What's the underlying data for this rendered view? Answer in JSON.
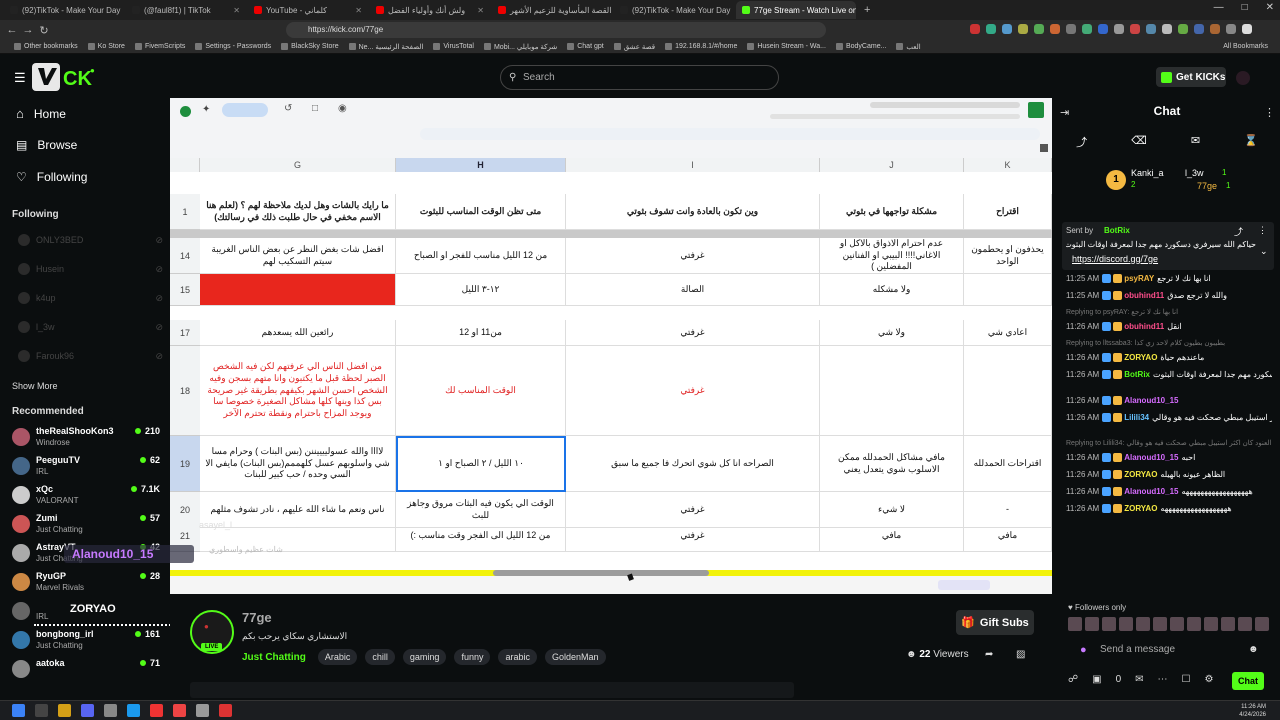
{
  "browser": {
    "tabs": [
      {
        "title": "(92)TikTok - Make Your Day",
        "color": "#222"
      },
      {
        "title": "(@faul8f1) | TikTok",
        "color": "#222"
      },
      {
        "title": "YouTube - كلماني",
        "color": "#e00"
      },
      {
        "title": "ولش أنك وأولياء الفضل",
        "color": "#e00"
      },
      {
        "title": "القصة المأساوية للزعيم الأشهر",
        "color": "#e00"
      },
      {
        "title": "(92)TikTok - Make Your Day",
        "color": "#222"
      },
      {
        "title": "77ge Stream - Watch Live on",
        "color": "#53fc18",
        "active": true
      }
    ],
    "url": "https://kick.com/77ge",
    "bookmarks": [
      "Other bookmarks",
      "Ko Store",
      "FivemScripts",
      "Settings - Passwords",
      "BlackSky Store",
      "Ne... الصفحة الرئيسية",
      "VirusTotal",
      "Mobi... شركة موبايلي",
      "Chat gpt",
      "قصة عشق",
      "192.168.8.1/#/home",
      "Husein Stream - Wa...",
      "BodyCame...",
      "العب"
    ],
    "all_bookmarks": "All Bookmarks"
  },
  "header": {
    "search_placeholder": "Search",
    "get_kicks": "Get KICKs"
  },
  "sidebar": {
    "nav": [
      {
        "label": "Home",
        "icon": "home-icon"
      },
      {
        "label": "Browse",
        "icon": "browse-icon"
      },
      {
        "label": "Following",
        "icon": "heart-icon"
      }
    ],
    "following_title": "Following",
    "following": [
      "ONLY3BED",
      "Husein",
      "k4up",
      "l_3w",
      "Farouk96"
    ],
    "show_more": "Show More",
    "recommended_title": "Recommended",
    "recommended": [
      {
        "name": "theRealShooKon3",
        "cat": "Windrose",
        "viewers": "210"
      },
      {
        "name": "PeeguuTV",
        "cat": "IRL",
        "viewers": "62"
      },
      {
        "name": "xQc",
        "cat": "VALORANT",
        "viewers": "7.1K"
      },
      {
        "name": "Zumi",
        "cat": "Just Chatting",
        "viewers": "57"
      },
      {
        "name": "AstrayVT",
        "cat": "Just Chatting",
        "viewers": "42"
      },
      {
        "name": "RyuGP",
        "cat": "Marvel Rivals",
        "viewers": "28"
      },
      {
        "name": "",
        "cat": "IRL",
        "viewers": ""
      },
      {
        "name": "bongbong_irl",
        "cat": "Just Chatting",
        "viewers": "161"
      },
      {
        "name": "aatoka",
        "cat": "",
        "viewers": "71"
      }
    ]
  },
  "sheet": {
    "columns": [
      "G",
      "H",
      "I",
      "J",
      "K"
    ],
    "rows": [
      {
        "n": "1",
        "cells": [
          "ما رايك بالشات وهل لديك ملاحظة لهم ؟ (لعلم هنا الاسم مخفي في حال طلبت ذلك في رسالتك)",
          "متى تظن الوقت المناسب للبثوت",
          "وين تكون بالعادة وانت تشوف بثوتي",
          "مشكلة تواجهها في بثوتي",
          "اقتراح"
        ]
      },
      {
        "n": "14",
        "cells": [
          "افضل شات بغض النظر عن بعض الناس الغريبة سيتم التسكيب لهم",
          "من 12 الليل مناسب للفجر او الصباح",
          "غرفتي",
          "عدم احترام الاذواق بالاكل او الاغاني!!!! البيبي او الفنانين المفضلين )",
          "يحذفون او يحطمون الواحد"
        ]
      },
      {
        "n": "15",
        "cells": [
          "",
          "١٢-٣ الليل",
          "الصالة",
          "ولا مشكله",
          ""
        ]
      },
      {
        "n": "17",
        "cells": [
          "رائعين الله يسعدهم",
          "من11 او 12",
          "غرفتي",
          "ولا شي",
          "اعادي شي"
        ]
      },
      {
        "n": "18",
        "cells": [
          "من افضل الناس الي عرفتهم لكن فيه الشخص الصبر لحظة قبل ما يكتبون وانا متهم بسجن وفيه الشخص احسن الشهر بكيفهم بطريقة غير صريحة بس كذا وينها كلها مشاكل الصغيرة خصوصا سا ويوجد المزاح باحترام ونقطة تحترم الآخر",
          "الوقت المناسب لك",
          "غرفتي",
          "",
          ""
        ]
      },
      {
        "n": "19",
        "cells": [
          "لاااا والله عسولييييننن (بس البنات ) وحرام مسا شي واسلوبهم عسل كلهممم(بس البنات) مايفي الا السي وحده / حب كبير للبنات",
          "١٠ الليل / ٢ الصباح او ١",
          "الصراحه انا كل شوي اتحرك فا جميع ما سبق",
          "مافي مشاكل الحمدلله ممكن الاسلوب شوي يتعدل يعني",
          "اقتراحات الحمدلله"
        ]
      },
      {
        "n": "20",
        "cells": [
          "ناس ونعم ما شاء الله عليهم ، نادر تشوف مثلهم",
          "الوقت الي يكون فيه البثات مروق وجاهز للبث",
          "غرفتي",
          "لا شيء",
          "-"
        ]
      },
      {
        "n": "21",
        "cells": [
          "",
          "من 12 الليل الى الفجر وقت مناسب :)",
          "غرفتي",
          "مافي",
          "مافي"
        ]
      }
    ],
    "overlay_names": {
      "alanoud": "Alanoud10_15",
      "zoryao": "ZORYAO",
      "asayel": "asayel_l",
      "line": "شات عظيم واسطوري"
    }
  },
  "stream": {
    "channel": "77ge",
    "title": "الاستشاري سكاي يرحب بكم",
    "live": "LIVE",
    "category": "Just Chatting",
    "tags": [
      "Arabic",
      "chill",
      "gaming",
      "funny",
      "arabic",
      "GoldenMan"
    ],
    "gift_subs": "Gift Subs",
    "viewers": "22",
    "viewers_label": "Viewers"
  },
  "chat": {
    "title": "Chat",
    "top_gifters": [
      {
        "name": "Kanki_a",
        "n": "2"
      },
      {
        "name": "l_3w",
        "n": "1"
      },
      {
        "name": "77ge",
        "n": "1"
      }
    ],
    "pinned": {
      "user": "BotRix",
      "label": "Sent by",
      "text": "حياكم الله سيرفري دسكورد مهم جدا لمعرفة اوقات البثوت",
      "link": "https://discord.gg/7ge"
    },
    "messages": [
      {
        "time": "11:25 AM",
        "user": "psyRAY",
        "color": "#f4b942",
        "text": "انا بها نك لا ترجع"
      },
      {
        "time": "11:25 AM",
        "user": "obuhind11",
        "color": "#ff4e8c",
        "text": "والله لا ترجع صدق"
      },
      {
        "reply": "Replying to psyRAY: انا بها نك لا ترجع"
      },
      {
        "time": "11:26 AM",
        "user": "obuhind11",
        "color": "#ff4e8c",
        "text": "انقل"
      },
      {
        "reply": "Replying to lltssaba3: بطيبون بطيون كلام لاحد زي كذا"
      },
      {
        "time": "11:26 AM",
        "user": "ZORYAO",
        "color": "#f4e842",
        "text": "ماعندهم حياة"
      },
      {
        "time": "11:26 AM",
        "user": "BotRix",
        "color": "#53fc18",
        "text": "حياكم الله سيرفري دسكورد مهم جدا لمعرفة اوقات البثوت https://discord.gg/7ge"
      },
      {
        "time": "11:26 AM",
        "user": "Alanoud10_15",
        "color": "#d66cff",
        "text": ""
      },
      {
        "time": "11:26 AM",
        "user": "Lilili34",
        "color": "#66c2ff",
        "text": "استيبل العنود كان اكثر استيبل مبطي صحكت فيه هو وقالي"
      },
      {
        "reply": "Replying to Lilili34: استيبل العنود كان اكثر استيبل مبطي صحكت فيه هو وقالي"
      },
      {
        "time": "11:26 AM",
        "user": "Alanoud10_15",
        "color": "#d66cff",
        "text": "احبه"
      },
      {
        "time": "11:26 AM",
        "user": "ZORYAO",
        "color": "#f4e842",
        "text": "الظاهر عيونه بالهيله"
      },
      {
        "time": "11:26 AM",
        "user": "Alanoud10_15",
        "color": "#d66cff",
        "text": "ههههههههههههههههههه"
      },
      {
        "time": "11:26 AM",
        "user": "ZORYAO",
        "color": "#f4e842",
        "text": "ههههههههههههههههههه"
      }
    ],
    "followers_only": "Followers only",
    "input_placeholder": "Send a message",
    "send": "Chat",
    "points": "0"
  },
  "taskbar": {
    "time": "11:26 AM",
    "date": "4/24/2026"
  }
}
